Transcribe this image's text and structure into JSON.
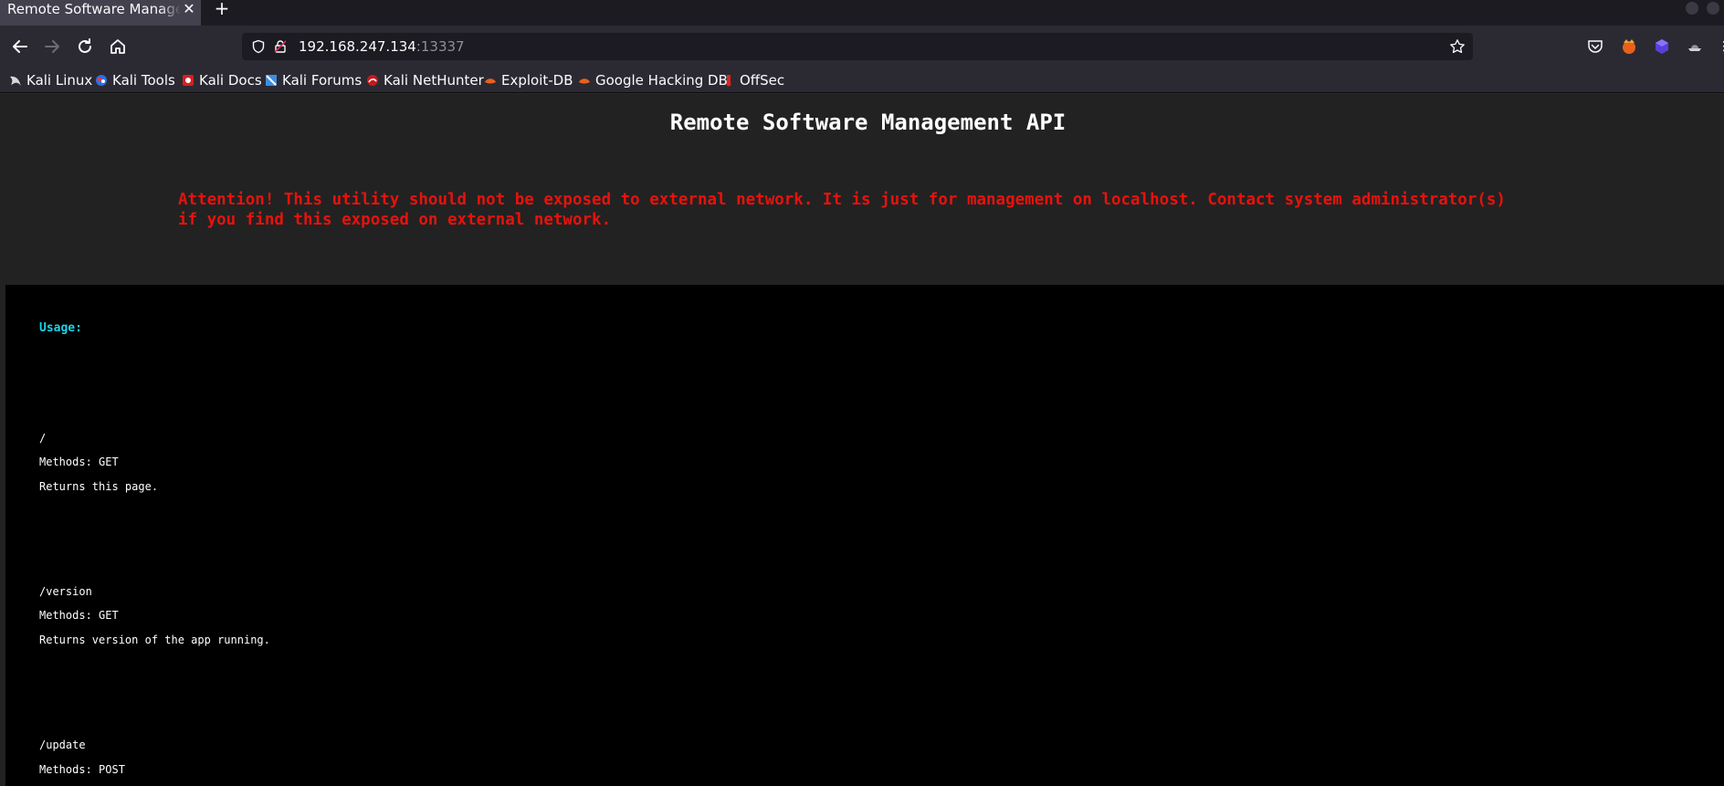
{
  "browser": {
    "tab": {
      "title": "Remote Software Management API",
      "close": "✕"
    },
    "new_tab": "+",
    "url": {
      "host": "192.168.247.134",
      "port": ":13337"
    },
    "bookmarks": [
      {
        "label": "Kali Linux",
        "icon": "kali-dragon-icon"
      },
      {
        "label": "Kali Tools",
        "icon": "kali-tools-icon"
      },
      {
        "label": "Kali Docs",
        "icon": "kali-docs-icon"
      },
      {
        "label": "Kali Forums",
        "icon": "kali-forums-icon"
      },
      {
        "label": "Kali NetHunter",
        "icon": "kali-nethunter-icon"
      },
      {
        "label": "Exploit-DB",
        "icon": "exploit-db-icon"
      },
      {
        "label": "Google Hacking DB",
        "icon": "ghdb-icon"
      },
      {
        "label": "OffSec",
        "icon": "offsec-icon"
      }
    ]
  },
  "page": {
    "title": "Remote Software Management API",
    "warning_line1": "Attention! This utility should not be exposed to external network. It is just for management on localhost. Contact system administrator(s)",
    "warning_line2": "if you find this exposed on external network.",
    "usage_label": "Usage:",
    "endpoints": [
      {
        "path": "/",
        "methods": "Methods: GET",
        "description": "Returns this page."
      },
      {
        "path": "/version",
        "methods": "Methods: GET",
        "description": "Returns version of the app running."
      },
      {
        "path": "/update",
        "methods": "Methods: POST",
        "description": ""
      }
    ]
  },
  "colors": {
    "warning": "#e8120c",
    "usage_heading": "#19d4e8",
    "panel_background": "#000000",
    "page_background": "#222222"
  }
}
